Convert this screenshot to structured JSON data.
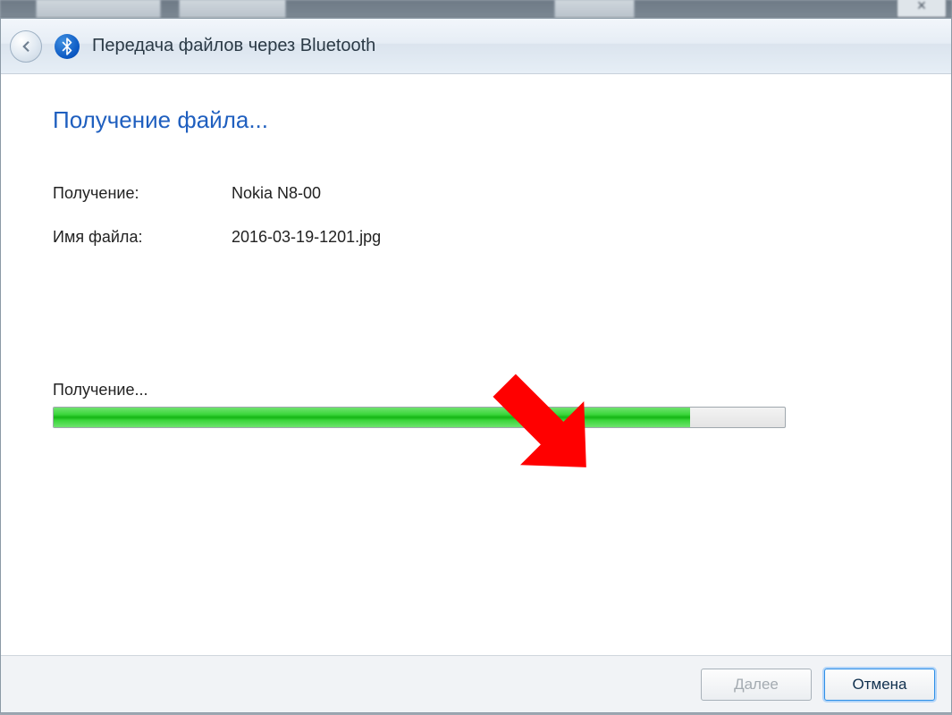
{
  "window": {
    "title": "Передача файлов через Bluetooth"
  },
  "content": {
    "heading": "Получение файла...",
    "receiving_label": "Получение:",
    "receiving_value": "Nokia N8-00",
    "filename_label": "Имя файла:",
    "filename_value": "2016-03-19-1201.jpg",
    "progress_label": "Получение...",
    "progress_percent": 87
  },
  "footer": {
    "next_label": "Далее",
    "cancel_label": "Отмена"
  },
  "colors": {
    "accent": "#1f5fbf",
    "progress_green": "#14b514",
    "arrow_red": "#ff0000"
  }
}
